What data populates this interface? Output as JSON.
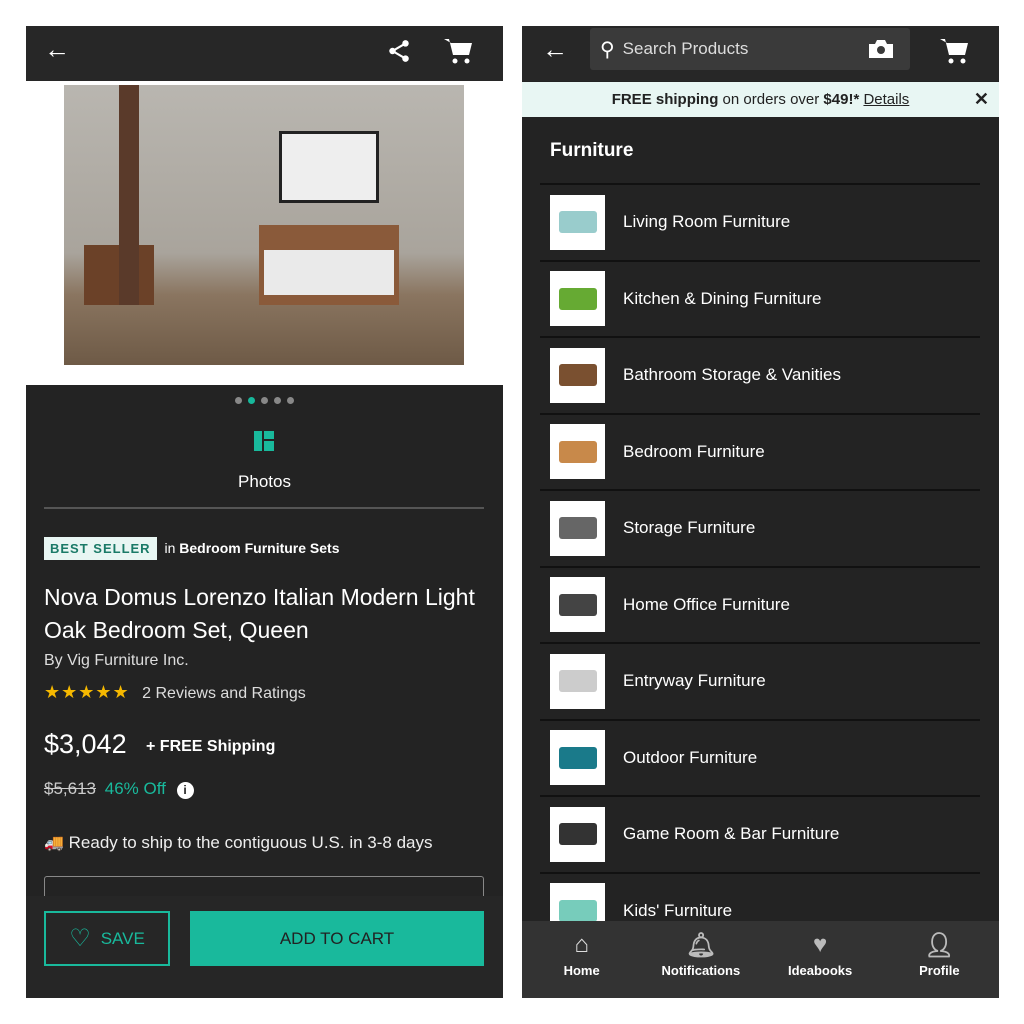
{
  "product": {
    "photos_label": "Photos",
    "carousel": {
      "count": 5,
      "active": 2
    },
    "badge": "BEST SELLER",
    "category_prefix": "in",
    "category": "Bedroom Furniture Sets",
    "title": "Nova Domus Lorenzo Italian Modern Light Oak Bedroom Set, Queen",
    "by": "By Vig Furniture Inc.",
    "rating": 5,
    "reviews": "2 Reviews and Ratings",
    "price": "$3,042",
    "shipping": "+ FREE Shipping",
    "old_price": "$5,613",
    "discount": "46% Off",
    "ship_info": "Ready to ship to the contiguous U.S. in 3-8 days",
    "save_label": "SAVE",
    "add_to_cart_label": "ADD TO CART"
  },
  "search": {
    "placeholder": "Search Products"
  },
  "banner": {
    "bold": "FREE shipping",
    "text": "on orders over",
    "amount": "$49!*",
    "link": "Details"
  },
  "section_title": "Furniture",
  "categories": [
    {
      "label": "Living Room Furniture",
      "icon": "sofa"
    },
    {
      "label": "Kitchen & Dining Furniture",
      "icon": "chair"
    },
    {
      "label": "Bathroom Storage & Vanities",
      "icon": "vanity"
    },
    {
      "label": "Bedroom Furniture",
      "icon": "bed"
    },
    {
      "label": "Storage Furniture",
      "icon": "sideboard"
    },
    {
      "label": "Home Office Furniture",
      "icon": "office-chair"
    },
    {
      "label": "Entryway Furniture",
      "icon": "bench"
    },
    {
      "label": "Outdoor Furniture",
      "icon": "adirondack-chair"
    },
    {
      "label": "Game Room & Bar Furniture",
      "icon": "foosball"
    },
    {
      "label": "Kids' Furniture",
      "icon": "kids-table"
    }
  ],
  "bottom_nav": [
    {
      "label": "Home",
      "icon": "home"
    },
    {
      "label": "Notifications",
      "icon": "bell"
    },
    {
      "label": "Ideabooks",
      "icon": "heart"
    },
    {
      "label": "Profile",
      "icon": "person"
    }
  ],
  "colors": {
    "accent": "#19b99c",
    "background": "#232323"
  }
}
